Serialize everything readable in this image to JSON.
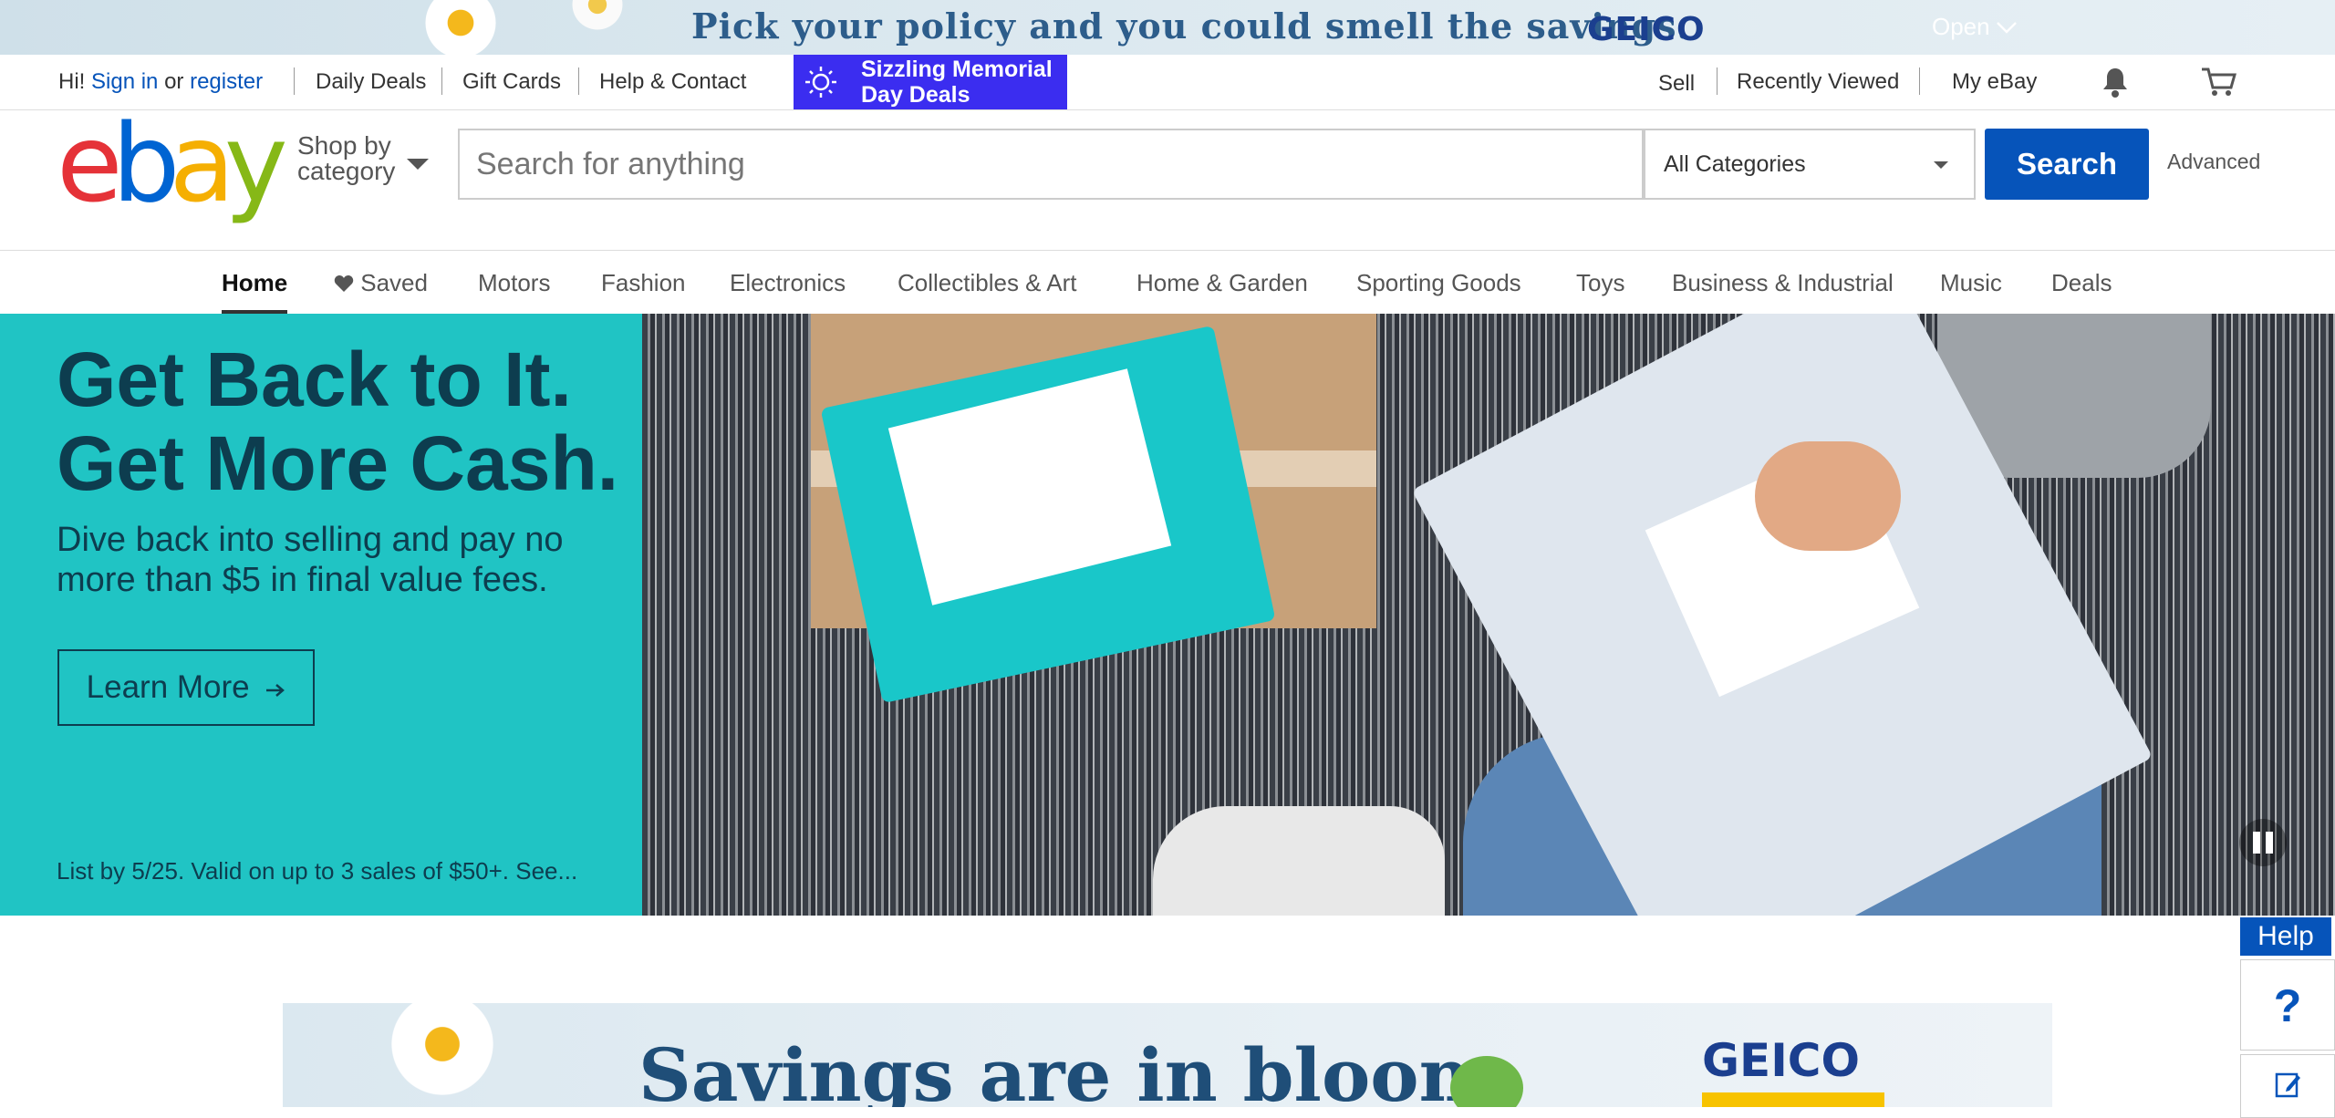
{
  "top_ad": {
    "headline": "Pick your policy and you could smell the savings.",
    "brand": "GEICO",
    "open_label": "Open"
  },
  "utility": {
    "greeting": "Hi!",
    "sign_in": "Sign in",
    "or": "or",
    "register": "register",
    "daily_deals": "Daily Deals",
    "gift_cards": "Gift Cards",
    "help_contact": "Help & Contact",
    "promo_line1": "Sizzling Memorial",
    "promo_line2": "Day Deals",
    "sell": "Sell",
    "recently_viewed": "Recently Viewed",
    "my_ebay": "My eBay"
  },
  "header": {
    "logo_letters": [
      "e",
      "b",
      "a",
      "y"
    ],
    "shop_by_line1": "Shop by",
    "shop_by_line2": "category",
    "search_placeholder": "Search for anything",
    "category_selected": "All Categories",
    "search_button": "Search",
    "advanced": "Advanced"
  },
  "nav": {
    "items": [
      "Home",
      "Saved",
      "Motors",
      "Fashion",
      "Electronics",
      "Collectibles & Art",
      "Home & Garden",
      "Sporting Goods",
      "Toys",
      "Business & Industrial",
      "Music",
      "Deals"
    ],
    "active": "Home"
  },
  "hero": {
    "title_line1": "Get Back to It.",
    "title_line2": "Get More Cash.",
    "subtitle": "Dive back into selling and pay no more than $5 in final value fees.",
    "cta": "Learn More",
    "legal": "List by 5/25. Valid on up to 3 sales of $50+. See..."
  },
  "bottom_ad": {
    "headline": "Savings are in bloom",
    "brand": "GEICO"
  },
  "help": {
    "label": "Help",
    "question": "?"
  },
  "colors": {
    "ebay_red": "#e53238",
    "ebay_blue": "#0064d2",
    "ebay_yellow": "#f5af02",
    "ebay_green": "#86b817",
    "search_button": "#0654ba",
    "hero_panel": "#20c4c4",
    "promo_badge": "#3b2df0"
  },
  "icons": [
    "chevron-down-icon",
    "sun-icon",
    "bell-icon",
    "cart-icon",
    "heart-icon",
    "arrow-right-icon",
    "pause-icon",
    "feedback-icon"
  ]
}
